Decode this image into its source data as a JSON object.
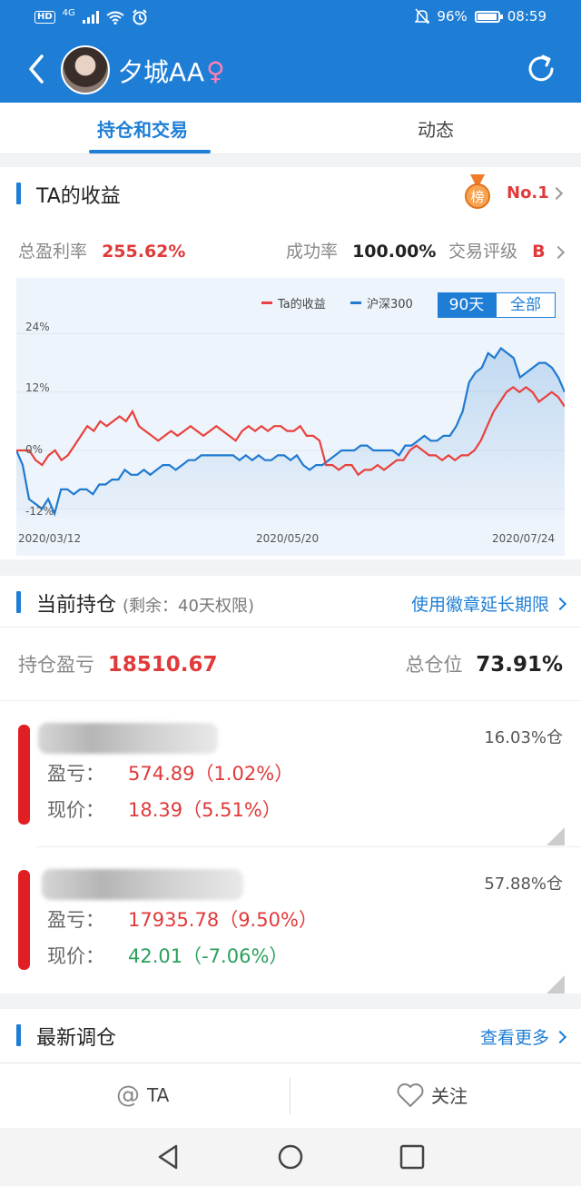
{
  "status_bar": {
    "left_hd": "HD",
    "left_net": "4G",
    "battery": "96%",
    "time": "08:59"
  },
  "header": {
    "username": "夕城AA",
    "gender_symbol": "♀"
  },
  "tabs": [
    {
      "label": "持仓和交易",
      "active": true
    },
    {
      "label": "动态",
      "active": false
    }
  ],
  "earnings": {
    "title": "TA的收益",
    "rank_badge": "榜",
    "rank": "No.1",
    "total_label": "总盈利率",
    "total_value": "255.62%",
    "success_label": "成功率",
    "success_value": "100.00%",
    "grade_label": "交易评级",
    "grade_value": "B"
  },
  "chart_data": {
    "type": "line",
    "legend": [
      "Ta的收益",
      "沪深300"
    ],
    "range_options": [
      "90天",
      "全部"
    ],
    "selected_range": "90天",
    "y_ticks": [
      "24%",
      "12%",
      "0%",
      "-12%"
    ],
    "x_ticks": [
      "2020/03/12",
      "2020/05/20",
      "2020/07/24"
    ],
    "ylim": [
      -14,
      28
    ],
    "colors": {
      "ta": "#e8413e",
      "hs300": "#1f7ad0"
    },
    "series": [
      {
        "name": "Ta的收益",
        "values": [
          0,
          0,
          0,
          -2,
          -3,
          -1,
          0,
          -2,
          -1,
          1,
          3,
          5,
          4,
          6,
          5,
          6,
          7,
          6,
          8,
          5,
          4,
          3,
          2,
          3,
          4,
          3,
          4,
          5,
          4,
          3,
          4,
          5,
          4,
          3,
          2,
          4,
          5,
          4,
          5,
          4,
          5,
          5,
          4,
          4,
          5,
          3,
          3,
          2,
          -3,
          -3,
          -4,
          -3,
          -3,
          -5,
          -4,
          -4,
          -3,
          -4,
          -3,
          -2,
          -2,
          0,
          1,
          0,
          -1,
          -1,
          -2,
          -1,
          -2,
          -1,
          -1,
          0,
          2,
          5,
          8,
          10,
          12,
          13,
          12,
          13,
          12,
          10,
          11,
          12,
          11,
          9
        ]
      },
      {
        "name": "沪深300",
        "values": [
          0,
          -3,
          -10,
          -11,
          -12,
          -10,
          -13,
          -8,
          -8,
          -9,
          -8,
          -8,
          -9,
          -7,
          -7,
          -6,
          -6,
          -4,
          -5,
          -5,
          -4,
          -5,
          -4,
          -3,
          -3,
          -4,
          -3,
          -2,
          -2,
          -1,
          -1,
          -1,
          -1,
          -1,
          -1,
          -2,
          -1,
          -2,
          -1,
          -2,
          -2,
          -1,
          -1,
          -2,
          -1,
          -3,
          -4,
          -3,
          -3,
          -2,
          -1,
          0,
          0,
          0,
          1,
          1,
          0,
          0,
          0,
          0,
          -1,
          1,
          1,
          2,
          3,
          2,
          2,
          3,
          3,
          5,
          8,
          14,
          16,
          17,
          20,
          19,
          21,
          20,
          19,
          15,
          16,
          17,
          18,
          18,
          17,
          15,
          12
        ]
      }
    ]
  },
  "holdings": {
    "title": "当前持仓",
    "subtitle": "(剩余：40天权限)",
    "extend_link": "使用徽章延长期限",
    "pnl_label": "持仓盈亏",
    "pnl_value": "18510.67",
    "total_pos_label": "总仓位",
    "total_pos_value": "73.91%",
    "items": [
      {
        "weight": "16.03%仓",
        "pnl_label": "盈亏：",
        "pnl_value": "574.89（1.02%）",
        "price_label": "现价：",
        "price_value": "18.39（5.51%）",
        "price_color": "#e03a3a"
      },
      {
        "weight": "57.88%仓",
        "pnl_label": "盈亏：",
        "pnl_value": "17935.78（9.50%）",
        "price_label": "现价：",
        "price_value": "42.01（-7.06%）",
        "price_color": "#2aa15b"
      }
    ]
  },
  "rebalance": {
    "title": "最新调仓",
    "more_link": "查看更多"
  },
  "bottom_actions": {
    "at_label": "TA",
    "follow_label": "关注"
  }
}
